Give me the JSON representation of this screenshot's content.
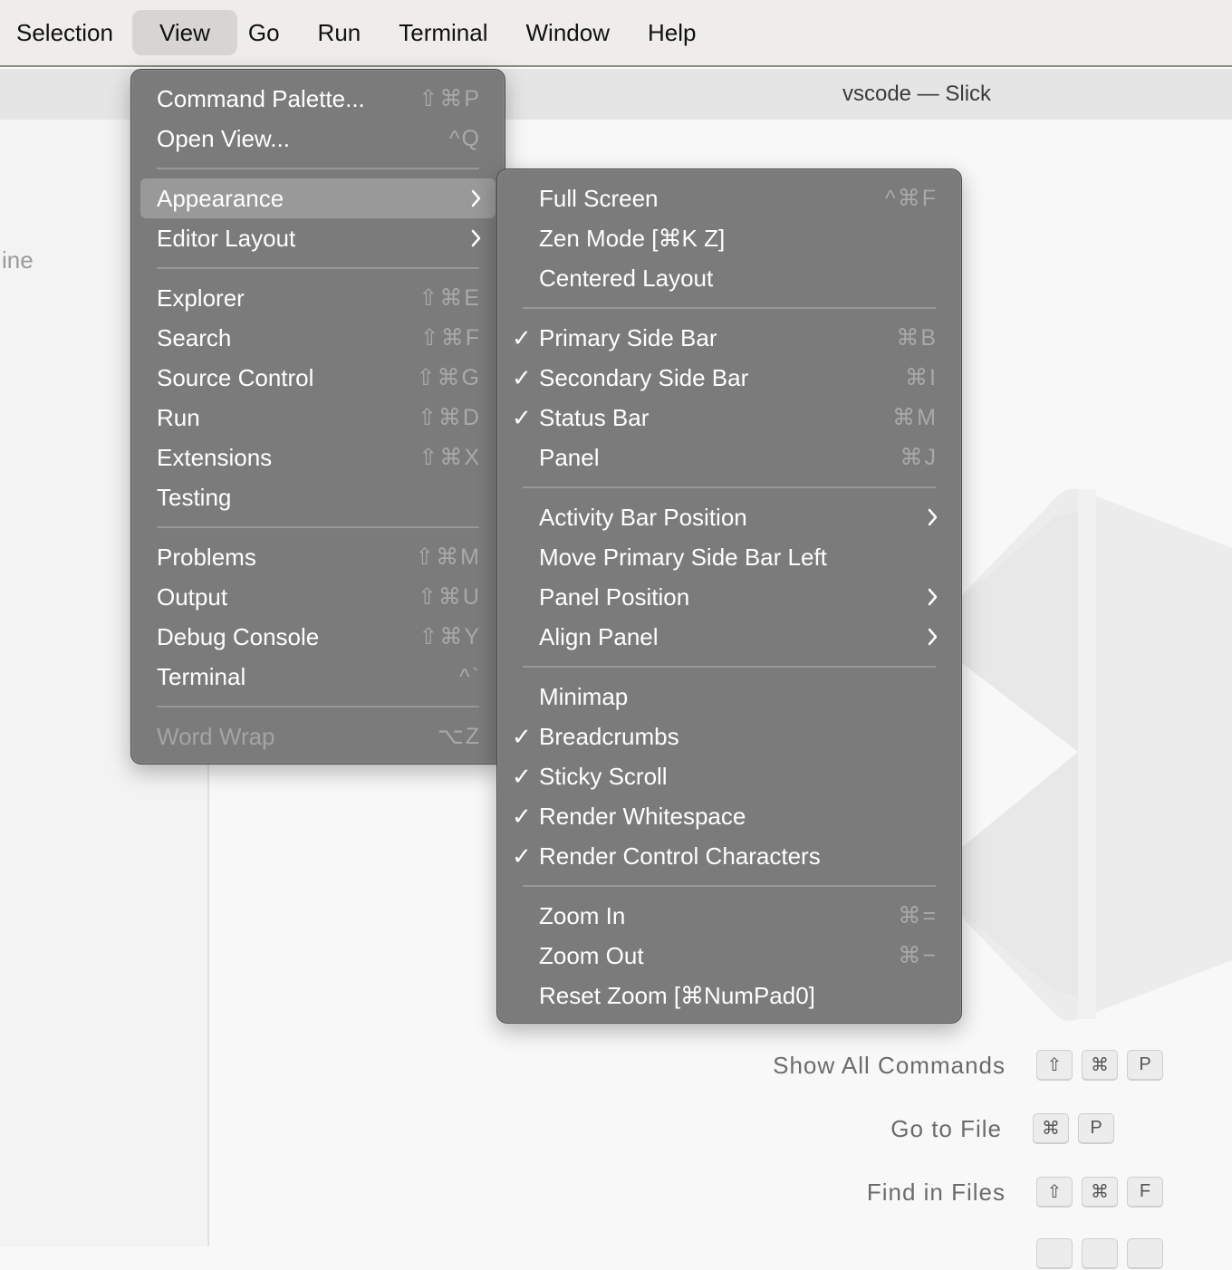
{
  "menubar": {
    "items": [
      "Selection",
      "View",
      "Go",
      "Run",
      "Terminal",
      "Window",
      "Help"
    ]
  },
  "window": {
    "title": "vscode — Slick"
  },
  "sidebar": {
    "partial_text": "ine"
  },
  "view_menu": {
    "items": [
      {
        "label": "Command Palette...",
        "shortcut": "⇧⌘P"
      },
      {
        "label": "Open View...",
        "shortcut": "^Q"
      },
      {
        "label": "Appearance"
      },
      {
        "label": "Editor Layout"
      },
      {
        "label": "Explorer",
        "shortcut": "⇧⌘E"
      },
      {
        "label": "Search",
        "shortcut": "⇧⌘F"
      },
      {
        "label": "Source Control",
        "shortcut": "⇧⌘G"
      },
      {
        "label": "Run",
        "shortcut": "⇧⌘D"
      },
      {
        "label": "Extensions",
        "shortcut": "⇧⌘X"
      },
      {
        "label": "Testing"
      },
      {
        "label": "Problems",
        "shortcut": "⇧⌘M"
      },
      {
        "label": "Output",
        "shortcut": "⇧⌘U"
      },
      {
        "label": "Debug Console",
        "shortcut": "⇧⌘Y"
      },
      {
        "label": "Terminal",
        "shortcut": "^`"
      },
      {
        "label": "Word Wrap",
        "shortcut": "⌥Z"
      }
    ]
  },
  "appearance_menu": {
    "items": [
      {
        "label": "Full Screen",
        "shortcut": "^⌘F",
        "checked": false
      },
      {
        "label": "Zen Mode [⌘K Z]",
        "checked": false
      },
      {
        "label": "Centered Layout",
        "checked": false
      },
      {
        "label": "Primary Side Bar",
        "shortcut": "⌘B",
        "checked": true
      },
      {
        "label": "Secondary Side Bar",
        "shortcut": "⌘I",
        "checked": true
      },
      {
        "label": "Status Bar",
        "shortcut": "⌘M",
        "checked": true
      },
      {
        "label": "Panel",
        "shortcut": "⌘J",
        "checked": false
      },
      {
        "label": "Activity Bar Position",
        "checked": false
      },
      {
        "label": "Move Primary Side Bar Left",
        "checked": false
      },
      {
        "label": "Panel Position",
        "checked": false
      },
      {
        "label": "Align Panel",
        "checked": false
      },
      {
        "label": "Minimap",
        "checked": false
      },
      {
        "label": "Breadcrumbs",
        "checked": true
      },
      {
        "label": "Sticky Scroll",
        "checked": true
      },
      {
        "label": "Render Whitespace",
        "checked": true
      },
      {
        "label": "Render Control Characters",
        "checked": true
      },
      {
        "label": "Zoom In",
        "shortcut": "⌘=",
        "checked": false
      },
      {
        "label": "Zoom Out",
        "shortcut": "⌘−",
        "checked": false
      },
      {
        "label": "Reset Zoom [⌘NumPad0]",
        "checked": false
      }
    ]
  },
  "shortcuts": [
    {
      "label": "Show All Commands",
      "keys": [
        "⇧",
        "⌘",
        "P"
      ]
    },
    {
      "label": "Go to File",
      "keys": [
        "⌘",
        "P"
      ]
    },
    {
      "label": "Find in Files",
      "keys": [
        "⇧",
        "⌘",
        "F"
      ]
    }
  ],
  "icons": {
    "check": "check-icon",
    "submenu": "chevron-right-icon"
  },
  "colors": {
    "menu_bg": "#7b7b7b",
    "highlight": "#999999",
    "menubar_bg": "#efede9"
  }
}
